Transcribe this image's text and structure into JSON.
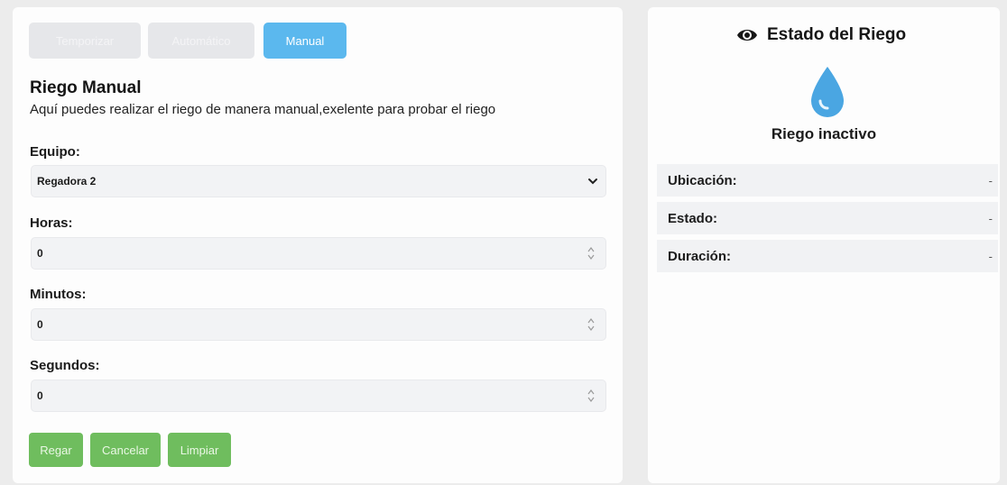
{
  "tabs": [
    {
      "label": "Temporizar"
    },
    {
      "label": "Automático"
    },
    {
      "label": "Manual"
    }
  ],
  "manual": {
    "title": "Riego Manual",
    "subtitle": "Aquí puedes realizar el riego de manera manual,exelente para probar el riego",
    "equipo_label": "Equipo:",
    "equipo_value": "Regadora 2",
    "horas_label": "Horas:",
    "horas_value": "0",
    "minutos_label": "Minutos:",
    "minutos_value": "0",
    "segundos_label": "Segundos:",
    "segundos_value": "0"
  },
  "buttons": {
    "regar": "Regar",
    "cancelar": "Cancelar",
    "limpiar": "Limpiar"
  },
  "status": {
    "title": "Estado del Riego",
    "state_text": "Riego inactivo",
    "rows": [
      {
        "label": "Ubicación:",
        "value": "-"
      },
      {
        "label": "Estado:",
        "value": "-"
      },
      {
        "label": "Duración:",
        "value": "-"
      }
    ]
  },
  "colors": {
    "accent": "#5bb8ee",
    "button_green": "#6fbd5e",
    "drop_blue": "#4aa6e2"
  },
  "icons": {
    "status": "eye-icon",
    "state": "water-drop-icon",
    "select": "chevron-down-icon",
    "number": "spinner-icon"
  }
}
